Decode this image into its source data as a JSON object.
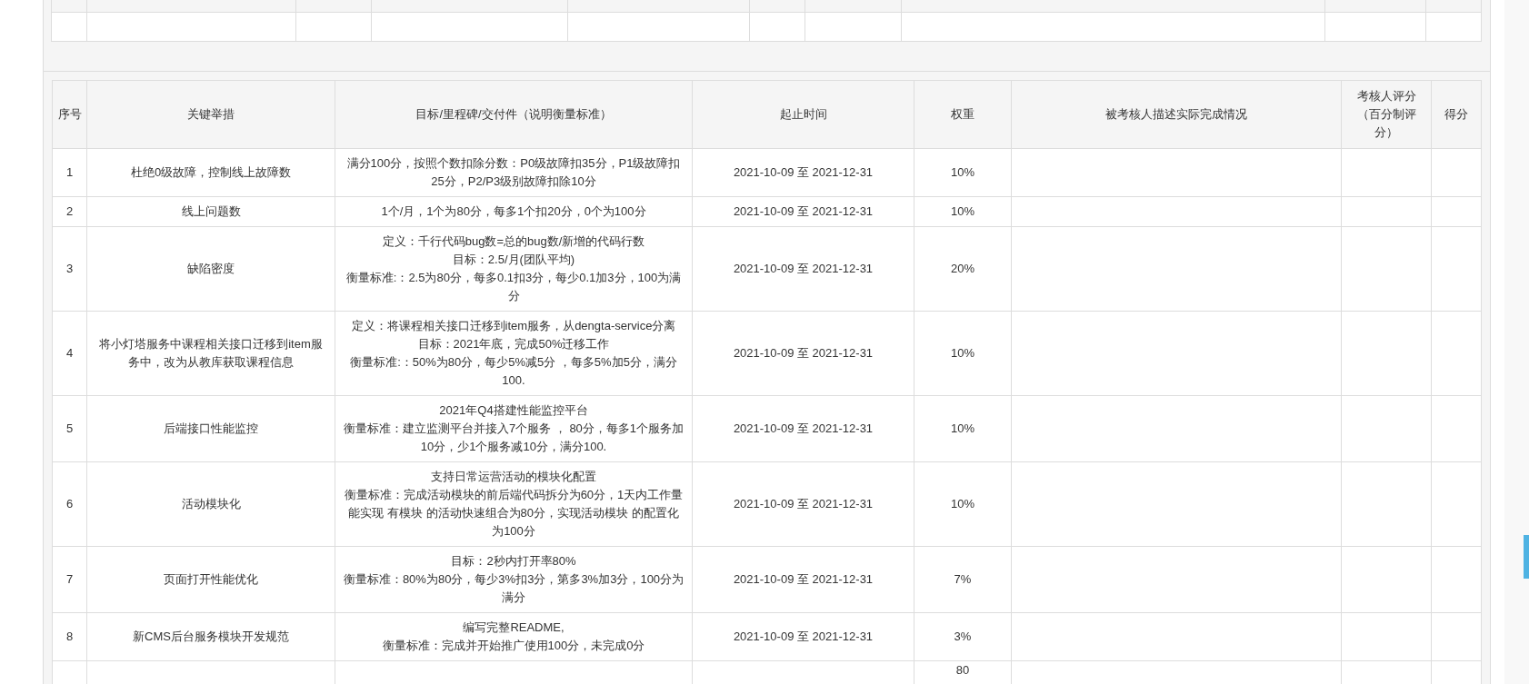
{
  "kpi_table": {
    "columns": [
      "序号",
      "关键举措",
      "目标/里程碑/交付件（说明衡量标准）",
      "起止时间",
      "权重",
      "被考核人描述实际完成情况",
      "考核人评分（百分制评分）",
      "得分"
    ],
    "rows": [
      {
        "no": "1",
        "measure": "杜绝0级故障，控制线上故障数",
        "goal": [
          "满分100分，按照个数扣除分数：P0级故障扣35分，P1级故障扣25分，P2/P3级别故障扣除10分"
        ],
        "period": "2021-10-09 至 2021-12-31",
        "weight": "10%"
      },
      {
        "no": "2",
        "measure": "线上问题数",
        "goal": [
          "1个/月，1个为80分，每多1个扣20分，0个为100分"
        ],
        "period": "2021-10-09 至 2021-12-31",
        "weight": "10%"
      },
      {
        "no": "3",
        "measure": "缺陷密度",
        "goal": [
          "定义：千行代码bug数=总的bug数/新增的代码行数",
          "目标：2.5/月(团队平均)",
          "衡量标准:：2.5为80分，每多0.1扣3分，每少0.1加3分，100为满分"
        ],
        "period": "2021-10-09 至 2021-12-31",
        "weight": "20%"
      },
      {
        "no": "4",
        "measure": "将小灯塔服务中课程相关接口迁移到item服务中，改为从教库获取课程信息",
        "goal": [
          "定义：将课程相关接口迁移到item服务，从dengta-service分离",
          "目标：2021年底，完成50%迁移工作",
          "衡量标准:：50%为80分，每少5%减5分 ，每多5%加5分，满分100."
        ],
        "period": "2021-10-09 至 2021-12-31",
        "weight": "10%"
      },
      {
        "no": "5",
        "measure": "后端接口性能监控",
        "goal": [
          "2021年Q4搭建性能监控平台",
          "衡量标准：建立监测平台并接入7个服务 ， 80分，每多1个服务加10分，少1个服务减10分，满分100."
        ],
        "period": "2021-10-09 至 2021-12-31",
        "weight": "10%"
      },
      {
        "no": "6",
        "measure": "活动模块化",
        "goal": [
          "支持日常运营活动的模块化配置",
          "衡量标准：完成活动模块的前后端代码拆分为60分，1天内工作量能实现 有模块 的活动快速组合为80分，实现活动模块 的配置化为100分"
        ],
        "period": "2021-10-09 至 2021-12-31",
        "weight": "10%"
      },
      {
        "no": "7",
        "measure": "页面打开性能优化",
        "goal": [
          "目标：2秒内打开率80%",
          "衡量标准：80%为80分，每少3%扣3分，第多3%加3分，100分为满分"
        ],
        "period": "2021-10-09 至 2021-12-31",
        "weight": "7%"
      },
      {
        "no": "8",
        "measure": "新CMS后台服务模块开发规范",
        "goal": [
          "编写完整README,",
          "衡量标准：完成并开始推广使用100分，未完成0分"
        ],
        "period": "2021-10-09 至 2021-12-31",
        "weight": "3%"
      }
    ],
    "partial_row": {
      "weight": "80"
    }
  }
}
